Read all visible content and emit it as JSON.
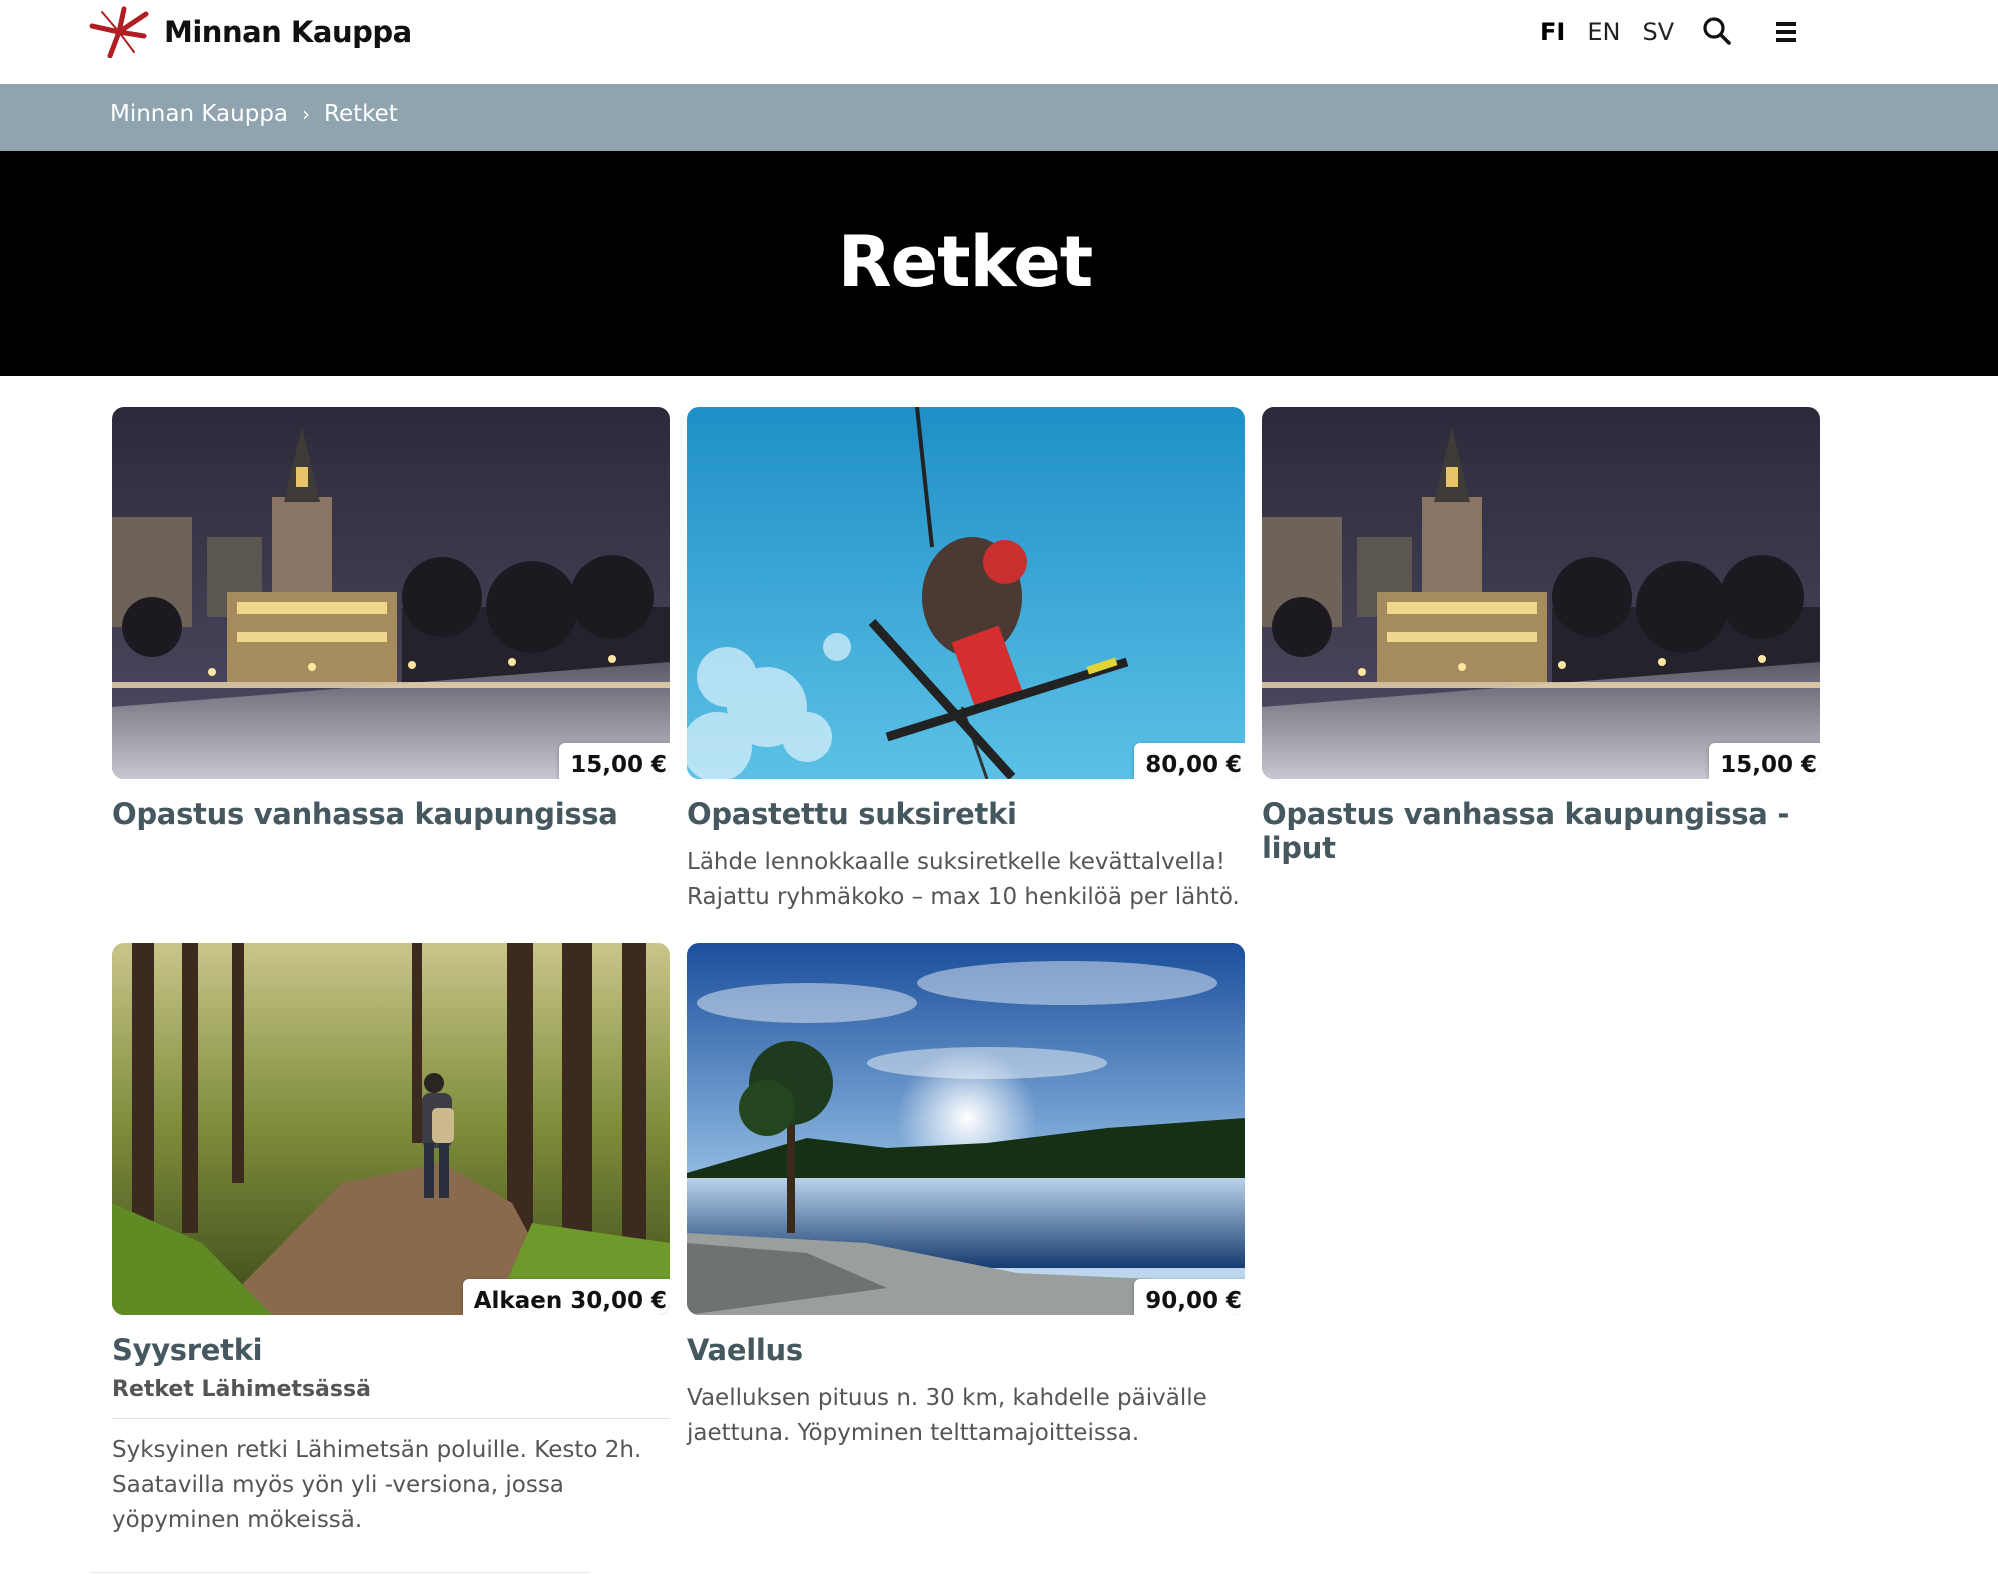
{
  "header": {
    "logo_text": "Minnan Kauppa",
    "languages": [
      "FI",
      "EN",
      "SV"
    ],
    "active_language": "FI"
  },
  "breadcrumb": [
    "Minnan Kauppa",
    "Retket"
  ],
  "hero": {
    "title": "Retket"
  },
  "products": [
    {
      "title": "Opastus vanhassa kaupungissa",
      "price": "15,00 €",
      "image": "old-town-night-cathedral"
    },
    {
      "title": "Opastettu suksiretki",
      "price": "80,00 €",
      "image": "freestyle-skier-blue-sky",
      "description": "Lähde lennokkaalle suksiretkelle kevättalvella! Rajattu ryhmäkoko – max 10 henkilöä per lähtö."
    },
    {
      "title": "Opastus vanhassa kaupungissa - liput",
      "price": "15,00 €",
      "image": "old-town-night-cathedral"
    },
    {
      "title": "Syysretki",
      "subtitle": "Retket Lähimetsässä",
      "price": "Alkaen 30,00 €",
      "image": "hiker-forest-path",
      "description": "Syksyinen retki Lähimetsän poluille. Kesto 2h. Saatavilla myös yön yli -versiona, jossa yöpyminen mökeissä."
    },
    {
      "title": "Vaellus",
      "price": "90,00 €",
      "image": "lake-sunburst-landscape",
      "description": "Vaelluksen pituus n. 30 km, kahdelle päivälle jaettuna. Yöpyminen telttamajoitteissa."
    }
  ],
  "colors": {
    "breadcrumb_bg": "#8fa4ae",
    "hero_bg": "#000000",
    "title_text": "#45575f",
    "logo_accent": "#b01e23"
  }
}
